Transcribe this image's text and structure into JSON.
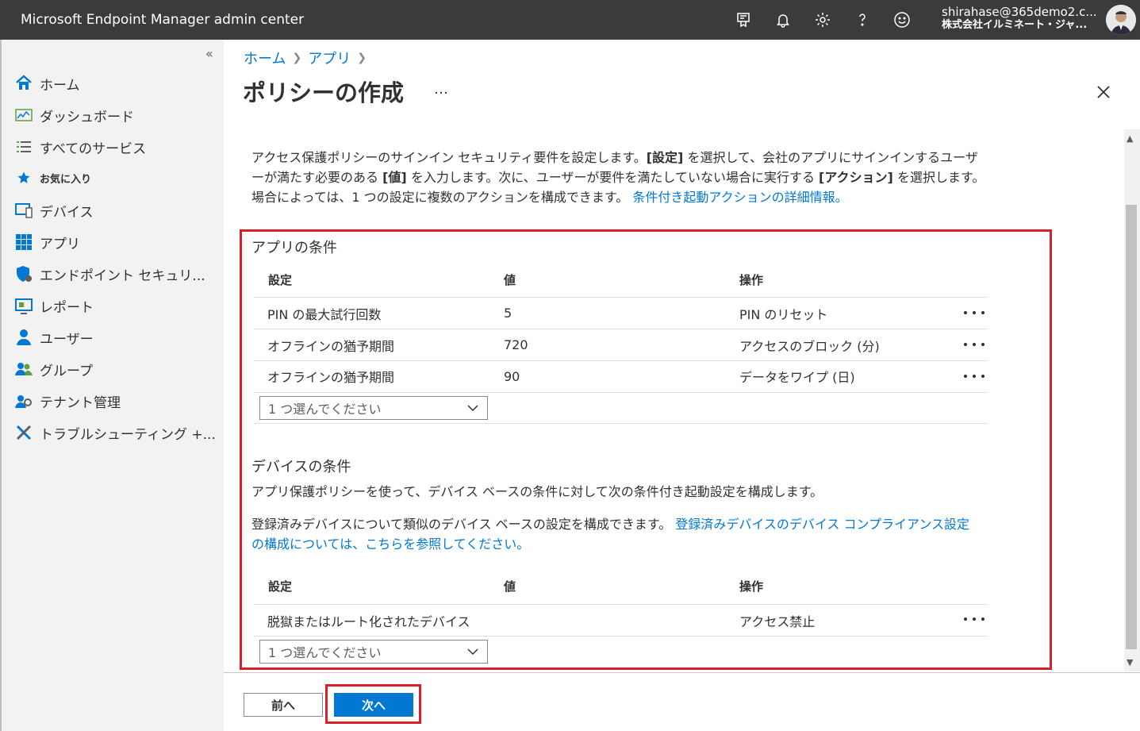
{
  "header": {
    "title": "Microsoft Endpoint Manager admin center",
    "account_email": "shirahase@365demo2.c...",
    "account_org": "株式会社イルミネート・ジャ...",
    "icons": [
      "feedback-portal-icon",
      "bell-icon",
      "gear-icon",
      "help-icon",
      "smiley-icon"
    ]
  },
  "sidebar": {
    "collapse_label": "«",
    "items": [
      {
        "label": "ホーム",
        "icon": "home-icon"
      },
      {
        "label": "ダッシュボード",
        "icon": "dashboard-icon"
      },
      {
        "label": "すべてのサービス",
        "icon": "list-icon"
      },
      {
        "label": "お気に入り",
        "icon": "star-icon"
      },
      {
        "label": "デバイス",
        "icon": "devices-icon"
      },
      {
        "label": "アプリ",
        "icon": "apps-icon"
      },
      {
        "label": "エンドポイント セキュリ...",
        "icon": "shield-icon"
      },
      {
        "label": "レポート",
        "icon": "report-icon"
      },
      {
        "label": "ユーザー",
        "icon": "user-icon"
      },
      {
        "label": "グループ",
        "icon": "group-icon"
      },
      {
        "label": "テナント管理",
        "icon": "tenant-icon"
      },
      {
        "label": "トラブルシューティング +...",
        "icon": "tools-icon"
      }
    ]
  },
  "breadcrumb": {
    "home": "ホーム",
    "apps": "アプリ"
  },
  "page": {
    "title": "ポリシーの作成",
    "more": "…"
  },
  "intro": {
    "p1": "アクセス保護ポリシーのサインイン セキュリティ要件を設定します。",
    "b1": "[設定]",
    "p2": " を選択して、会社のアプリにサインインするユーザーが満たす必要のある ",
    "b2": "[値]",
    "p3": " を入力します。次に、ユーザーが要件を満たしていない場合に実行する ",
    "b3": "[アクション]",
    "p4": " を選択します。場合によっては、1 つの設定に複数のアクションを構成できます。",
    "link": "条件付き起動アクションの詳細情報。"
  },
  "app_conditions": {
    "title": "アプリの条件",
    "headers": {
      "setting": "設定",
      "value": "値",
      "action": "操作"
    },
    "rows": [
      {
        "setting": "PIN の最大試行回数",
        "value": "5",
        "action": "PIN のリセット"
      },
      {
        "setting": "オフラインの猶予期間",
        "value": "720",
        "action": "アクセスのブロック (分)"
      },
      {
        "setting": "オフラインの猶予期間",
        "value": "90",
        "action": "データをワイプ (日)"
      }
    ],
    "select_placeholder": "1 つ選んでください"
  },
  "device_conditions": {
    "title": "デバイスの条件",
    "desc1": "アプリ保護ポリシーを使って、デバイス ベースの条件に対して次の条件付き起動設定を構成します。",
    "desc2": "登録済みデバイスについて類似のデバイス ベースの設定を構成できます。",
    "link_line1": "登録済みデバイスのデバイス コンプライアンス設定",
    "link_line2": "の構成については、こちらを参照してください。",
    "headers": {
      "setting": "設定",
      "value": "値",
      "action": "操作"
    },
    "rows": [
      {
        "setting": "脱獄またはルート化されたデバイス",
        "value": "",
        "action": "アクセス禁止"
      }
    ],
    "select_placeholder": "1 つ選んでください"
  },
  "footer": {
    "prev": "前へ",
    "next": "次へ"
  }
}
